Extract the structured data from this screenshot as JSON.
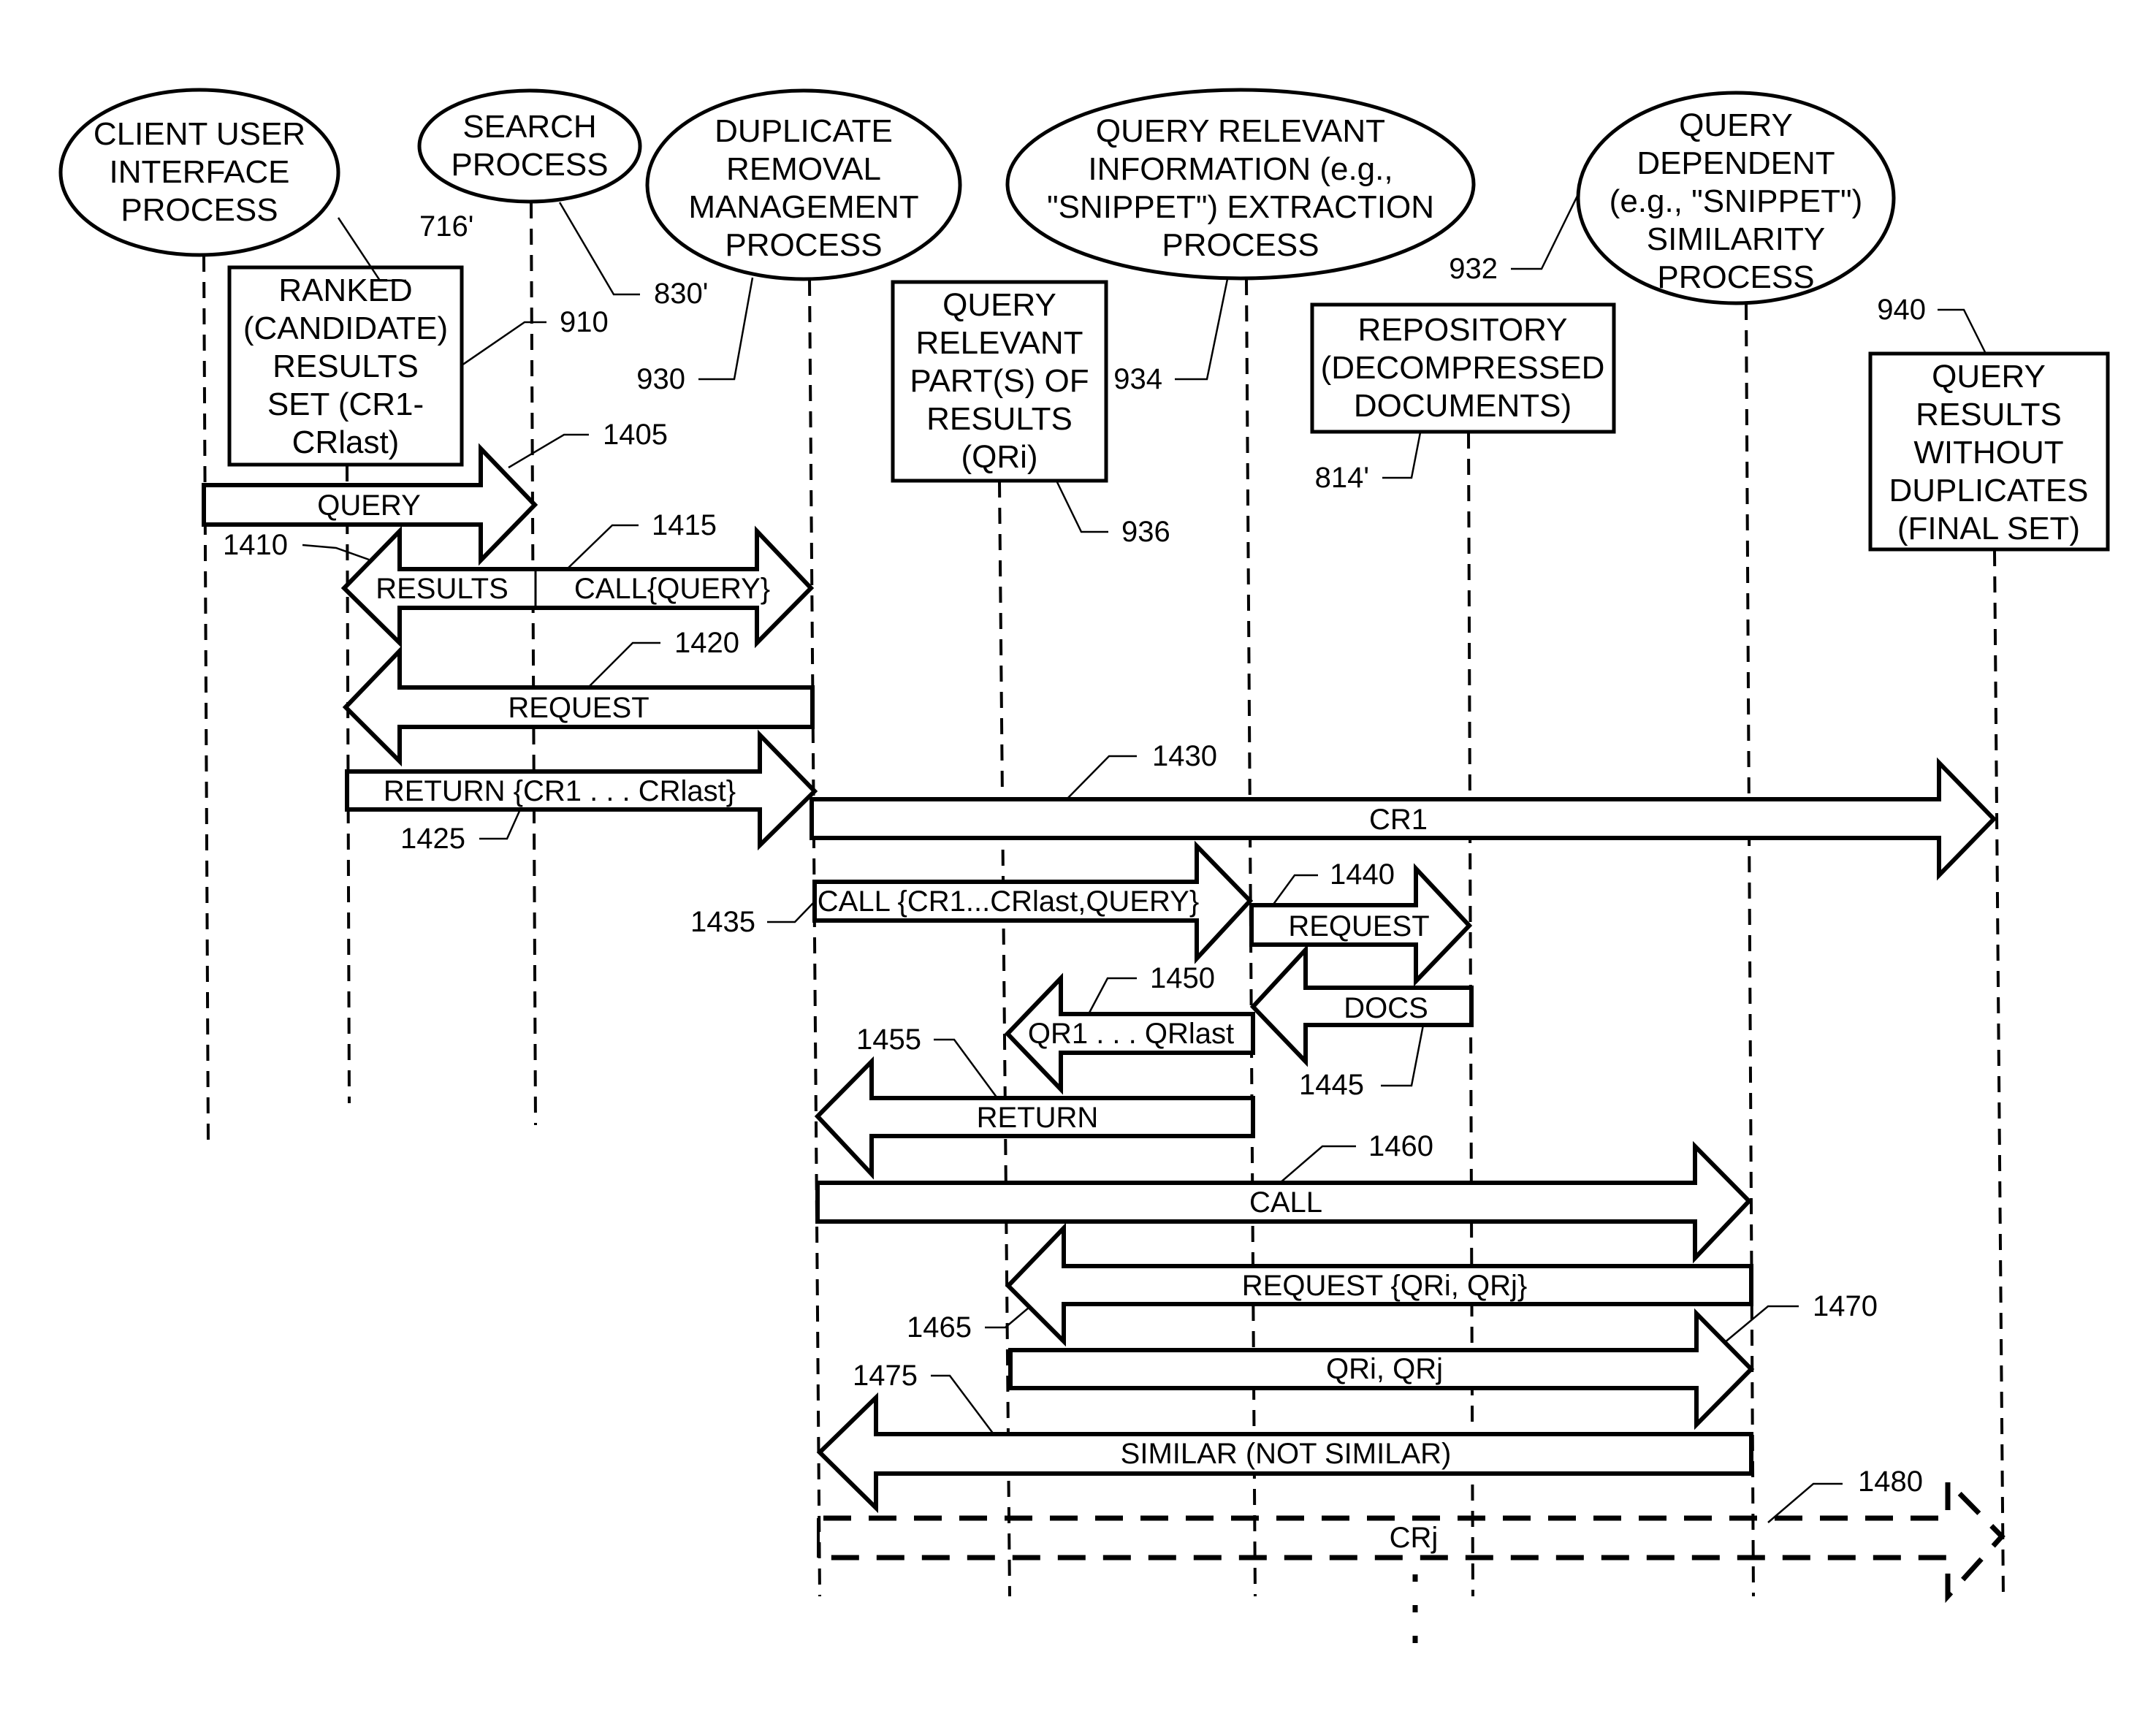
{
  "diagram": {
    "type": "sequence-diagram",
    "participants": [
      {
        "id": "client",
        "ref": "716'",
        "shape": "ellipse",
        "lines": [
          "CLIENT USER",
          "INTERFACE",
          "PROCESS"
        ]
      },
      {
        "id": "search",
        "ref": "830'",
        "shape": "ellipse",
        "lines": [
          "SEARCH",
          "PROCESS"
        ]
      },
      {
        "id": "duplicate",
        "ref": "930",
        "shape": "ellipse",
        "lines": [
          "DUPLICATE",
          "REMOVAL",
          "MANAGEMENT",
          "PROCESS"
        ]
      },
      {
        "id": "extraction",
        "ref": "934",
        "shape": "ellipse",
        "lines": [
          "QUERY RELEVANT",
          "INFORMATION (e.g.,",
          "\"SNIPPET\") EXTRACTION",
          "PROCESS"
        ]
      },
      {
        "id": "similarity",
        "ref": "932",
        "shape": "ellipse",
        "lines": [
          "QUERY",
          "DEPENDENT",
          "(e.g., \"SNIPPET\")",
          "SIMILARITY",
          "PROCESS"
        ]
      }
    ],
    "data_stores": [
      {
        "id": "ranked",
        "ref": "910",
        "lines": [
          "RANKED",
          "(CANDIDATE)",
          "RESULTS",
          "SET (CR1-",
          "CRlast)"
        ]
      },
      {
        "id": "qr_parts",
        "ref": "936",
        "lines": [
          "QUERY",
          "RELEVANT",
          "PART(S) OF",
          "RESULTS",
          "(QRi)"
        ]
      },
      {
        "id": "repository",
        "ref": "814'",
        "lines": [
          "REPOSITORY",
          "(DECOMPRESSED",
          "DOCUMENTS)"
        ]
      },
      {
        "id": "final",
        "ref": "940",
        "lines": [
          "QUERY",
          "RESULTS",
          "WITHOUT",
          "DUPLICATES",
          "(FINAL SET)"
        ]
      }
    ],
    "messages": [
      {
        "ref": "1405",
        "label": "QUERY",
        "from": "client",
        "to": "search"
      },
      {
        "ref": "1410",
        "label": "RESULTS",
        "from": "search",
        "to": "ranked"
      },
      {
        "ref": "1415",
        "label": "CALL{QUERY}",
        "from": "search",
        "to": "duplicate"
      },
      {
        "ref": "1420",
        "label": "REQUEST",
        "from": "duplicate",
        "to": "ranked"
      },
      {
        "ref": "1425",
        "label": "RETURN {CR1 . . . CRlast}",
        "from": "ranked",
        "to": "duplicate"
      },
      {
        "ref": "1430",
        "label": "CR1",
        "from": "duplicate",
        "to": "final"
      },
      {
        "ref": "1435",
        "label": "CALL {CR1...CRlast,QUERY}",
        "from": "duplicate",
        "to": "extraction"
      },
      {
        "ref": "1440",
        "label": "REQUEST",
        "from": "extraction",
        "to": "repository"
      },
      {
        "ref": "1445",
        "label": "DOCS",
        "from": "repository",
        "to": "extraction"
      },
      {
        "ref": "1450",
        "label": "QR1 . . . QRlast",
        "from": "extraction",
        "to": "qr_parts"
      },
      {
        "ref": "1455",
        "label": "RETURN",
        "from": "extraction",
        "to": "duplicate"
      },
      {
        "ref": "1460",
        "label": "CALL",
        "from": "duplicate",
        "to": "similarity"
      },
      {
        "ref": "1465",
        "label": "REQUEST {QRi, QRj}",
        "from": "similarity",
        "to": "qr_parts"
      },
      {
        "ref": "1470",
        "label": "QRi, QRj",
        "from": "qr_parts",
        "to": "similarity"
      },
      {
        "ref": "1475",
        "label": "SIMILAR (NOT SIMILAR)",
        "from": "similarity",
        "to": "duplicate"
      },
      {
        "ref": "1480",
        "label": "CRj",
        "from": "duplicate",
        "to": "final",
        "style": "dashed"
      }
    ],
    "continuation": "more messages follow (vertical ellipsis)"
  }
}
